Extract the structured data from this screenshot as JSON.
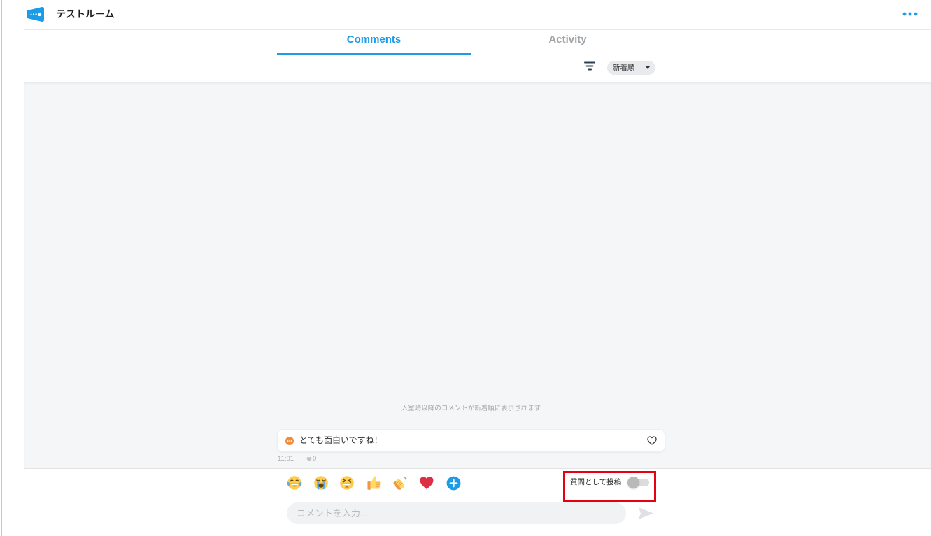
{
  "header": {
    "logo_icon": "megaphone-logo-icon",
    "room_title": "テストルーム",
    "menu_icon": "more-horizontal-icon"
  },
  "tabs": [
    {
      "label": "Comments",
      "active": true
    },
    {
      "label": "Activity",
      "active": false
    }
  ],
  "sort": {
    "filter_icon": "filter-icon",
    "selected": "新着順",
    "dropdown_icon": "caret-down-icon"
  },
  "feed": {
    "notice": "入室時以降のコメントが新着順に表示されます",
    "comments": [
      {
        "avatar_icon": "speech-bubble-icon",
        "text": "とても面白いですね！",
        "like_button_icon": "heart-outline-icon",
        "time": "11:01",
        "like_count_icon": "heart-icon",
        "likes": 0
      }
    ]
  },
  "reactions": [
    {
      "icon": "face-with-tears-of-joy-icon"
    },
    {
      "icon": "loudly-crying-face-icon"
    },
    {
      "icon": "grinning-squinting-face-icon"
    },
    {
      "icon": "thumbs-up-icon"
    },
    {
      "icon": "clapping-hands-icon"
    },
    {
      "icon": "red-heart-icon"
    },
    {
      "icon": "add-reaction-icon"
    }
  ],
  "composer": {
    "question_label": "質問として投稿",
    "question_toggle_on": false,
    "placeholder": "コメントを入力...",
    "send_icon": "send-icon"
  },
  "colors": {
    "accent": "#1c9be6",
    "inactive_tab": "#a0a4a8",
    "feed_background": "#f5f6f8",
    "avatar": "#f08c3a",
    "highlight": "#e60012"
  }
}
